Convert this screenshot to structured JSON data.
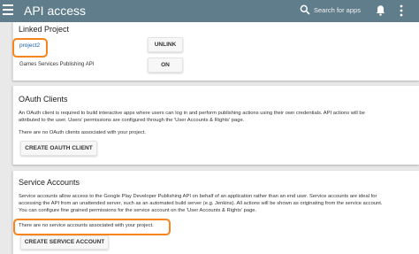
{
  "header": {
    "title": "API access",
    "search_placeholder": "Search for apps"
  },
  "linked_project": {
    "heading": "Linked Project",
    "project_name": "project2",
    "unlink_label": "UNLINK",
    "gsp_label": "Games Services Publishing API",
    "gsp_toggle_label": "ON"
  },
  "oauth": {
    "heading": "OAuth Clients",
    "description_line1": "An OAuth client is required to build interactive apps where users can log in and perform publishing actions using their own credentials. API actions will be",
    "description_line2": "attributed to the user. Users' permissions are configured through the 'User Accounts & Rights' page.",
    "empty_message": "There are no OAuth clients associated with your project.",
    "create_label": "CREATE OAUTH CLIENT"
  },
  "service": {
    "heading": "Service Accounts",
    "description_line1": "Service accounts allow access to the Google Play Developer Publishing API on behalf of an application rather than an end user. Service accounts are ideal for",
    "description_line2": "accessing the API from an unattended server, such as an automated build server (e.g. Jenkins). All actions will be shown as originating from the service account.",
    "description_line3": "You can configure fine grained permissions for the service account on the 'User Accounts & Rights' page.",
    "empty_message": "There are no service accounts associated with your project.",
    "create_label": "CREATE SERVICE ACCOUNT"
  },
  "colors": {
    "topbar": "#607d8b",
    "highlight": "#f7841c"
  },
  "icons": [
    "menu-icon",
    "search-icon",
    "bell-icon",
    "more-vert-icon"
  ]
}
